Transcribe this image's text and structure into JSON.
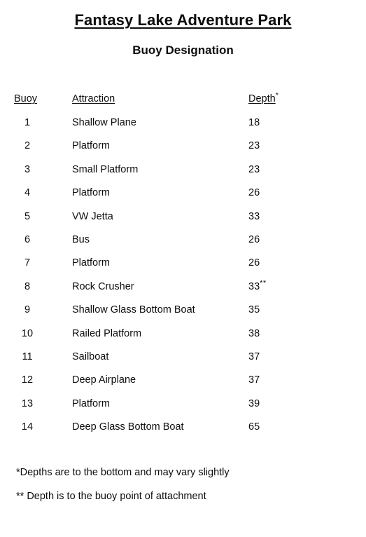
{
  "document": {
    "title": "Fantasy Lake Adventure Park",
    "subtitle": "Buoy Designation"
  },
  "table": {
    "headers": {
      "buoy": "Buoy",
      "attraction": "Attraction",
      "depth": "Depth",
      "depth_footnote_marker": "*"
    },
    "rows": [
      {
        "buoy": "1",
        "attraction": "Shallow Plane",
        "depth": "18",
        "note": ""
      },
      {
        "buoy": "2",
        "attraction": "Platform",
        "depth": "23",
        "note": ""
      },
      {
        "buoy": "3",
        "attraction": "Small Platform",
        "depth": "23",
        "note": ""
      },
      {
        "buoy": "4",
        "attraction": "Platform",
        "depth": "26",
        "note": ""
      },
      {
        "buoy": "5",
        "attraction": "VW Jetta",
        "depth": "33",
        "note": ""
      },
      {
        "buoy": "6",
        "attraction": "Bus",
        "depth": "26",
        "note": ""
      },
      {
        "buoy": "7",
        "attraction": "Platform",
        "depth": "26",
        "note": ""
      },
      {
        "buoy": "8",
        "attraction": "Rock Crusher",
        "depth": "33",
        "note": "**"
      },
      {
        "buoy": "9",
        "attraction": "Shallow Glass Bottom Boat",
        "depth": "35",
        "note": ""
      },
      {
        "buoy": "10",
        "attraction": "Railed Platform",
        "depth": "38",
        "note": ""
      },
      {
        "buoy": "11",
        "attraction": "Sailboat",
        "depth": "37",
        "note": ""
      },
      {
        "buoy": "12",
        "attraction": "Deep Airplane",
        "depth": "37",
        "note": ""
      },
      {
        "buoy": "13",
        "attraction": "Platform",
        "depth": "39",
        "note": ""
      },
      {
        "buoy": "14",
        "attraction": "Deep Glass Bottom Boat",
        "depth": "65",
        "note": ""
      }
    ]
  },
  "footnotes": [
    "*Depths are to the bottom and may vary slightly",
    "** Depth is to the buoy point of attachment"
  ],
  "colors": {
    "background": "#ffffff",
    "text": "#0d0d0d"
  }
}
